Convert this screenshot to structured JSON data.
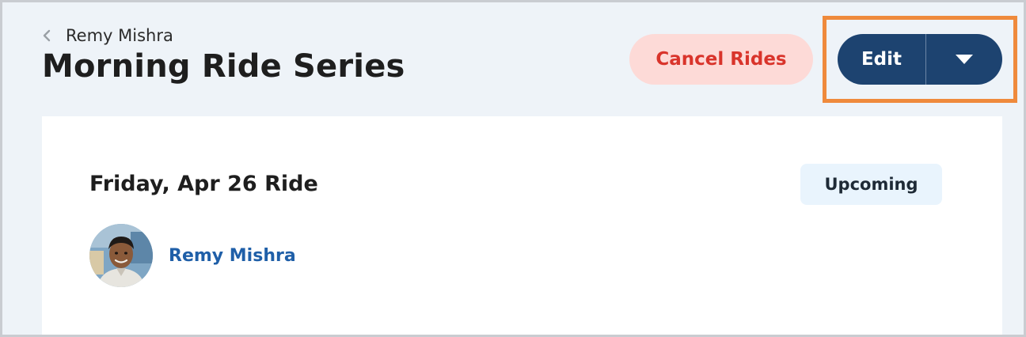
{
  "breadcrumb": {
    "label": "Remy Mishra",
    "icon": "chevron-left-icon"
  },
  "page": {
    "title": "Morning Ride Series"
  },
  "actions": {
    "cancel_label": "Cancel Rides",
    "edit_label": "Edit",
    "dropdown_icon": "caret-down-icon"
  },
  "ride": {
    "title": "Friday, Apr 26 Ride",
    "status": "Upcoming",
    "rider": {
      "name": "Remy Mishra",
      "avatar_icon": "rider-avatar"
    }
  },
  "colors": {
    "background": "#eef3f8",
    "primary": "#1d4370",
    "danger": "#d9342b",
    "danger_bg": "#fddad7",
    "link": "#1f5fa8",
    "highlight": "#ef8a3c",
    "badge_bg": "#e9f4fd"
  }
}
